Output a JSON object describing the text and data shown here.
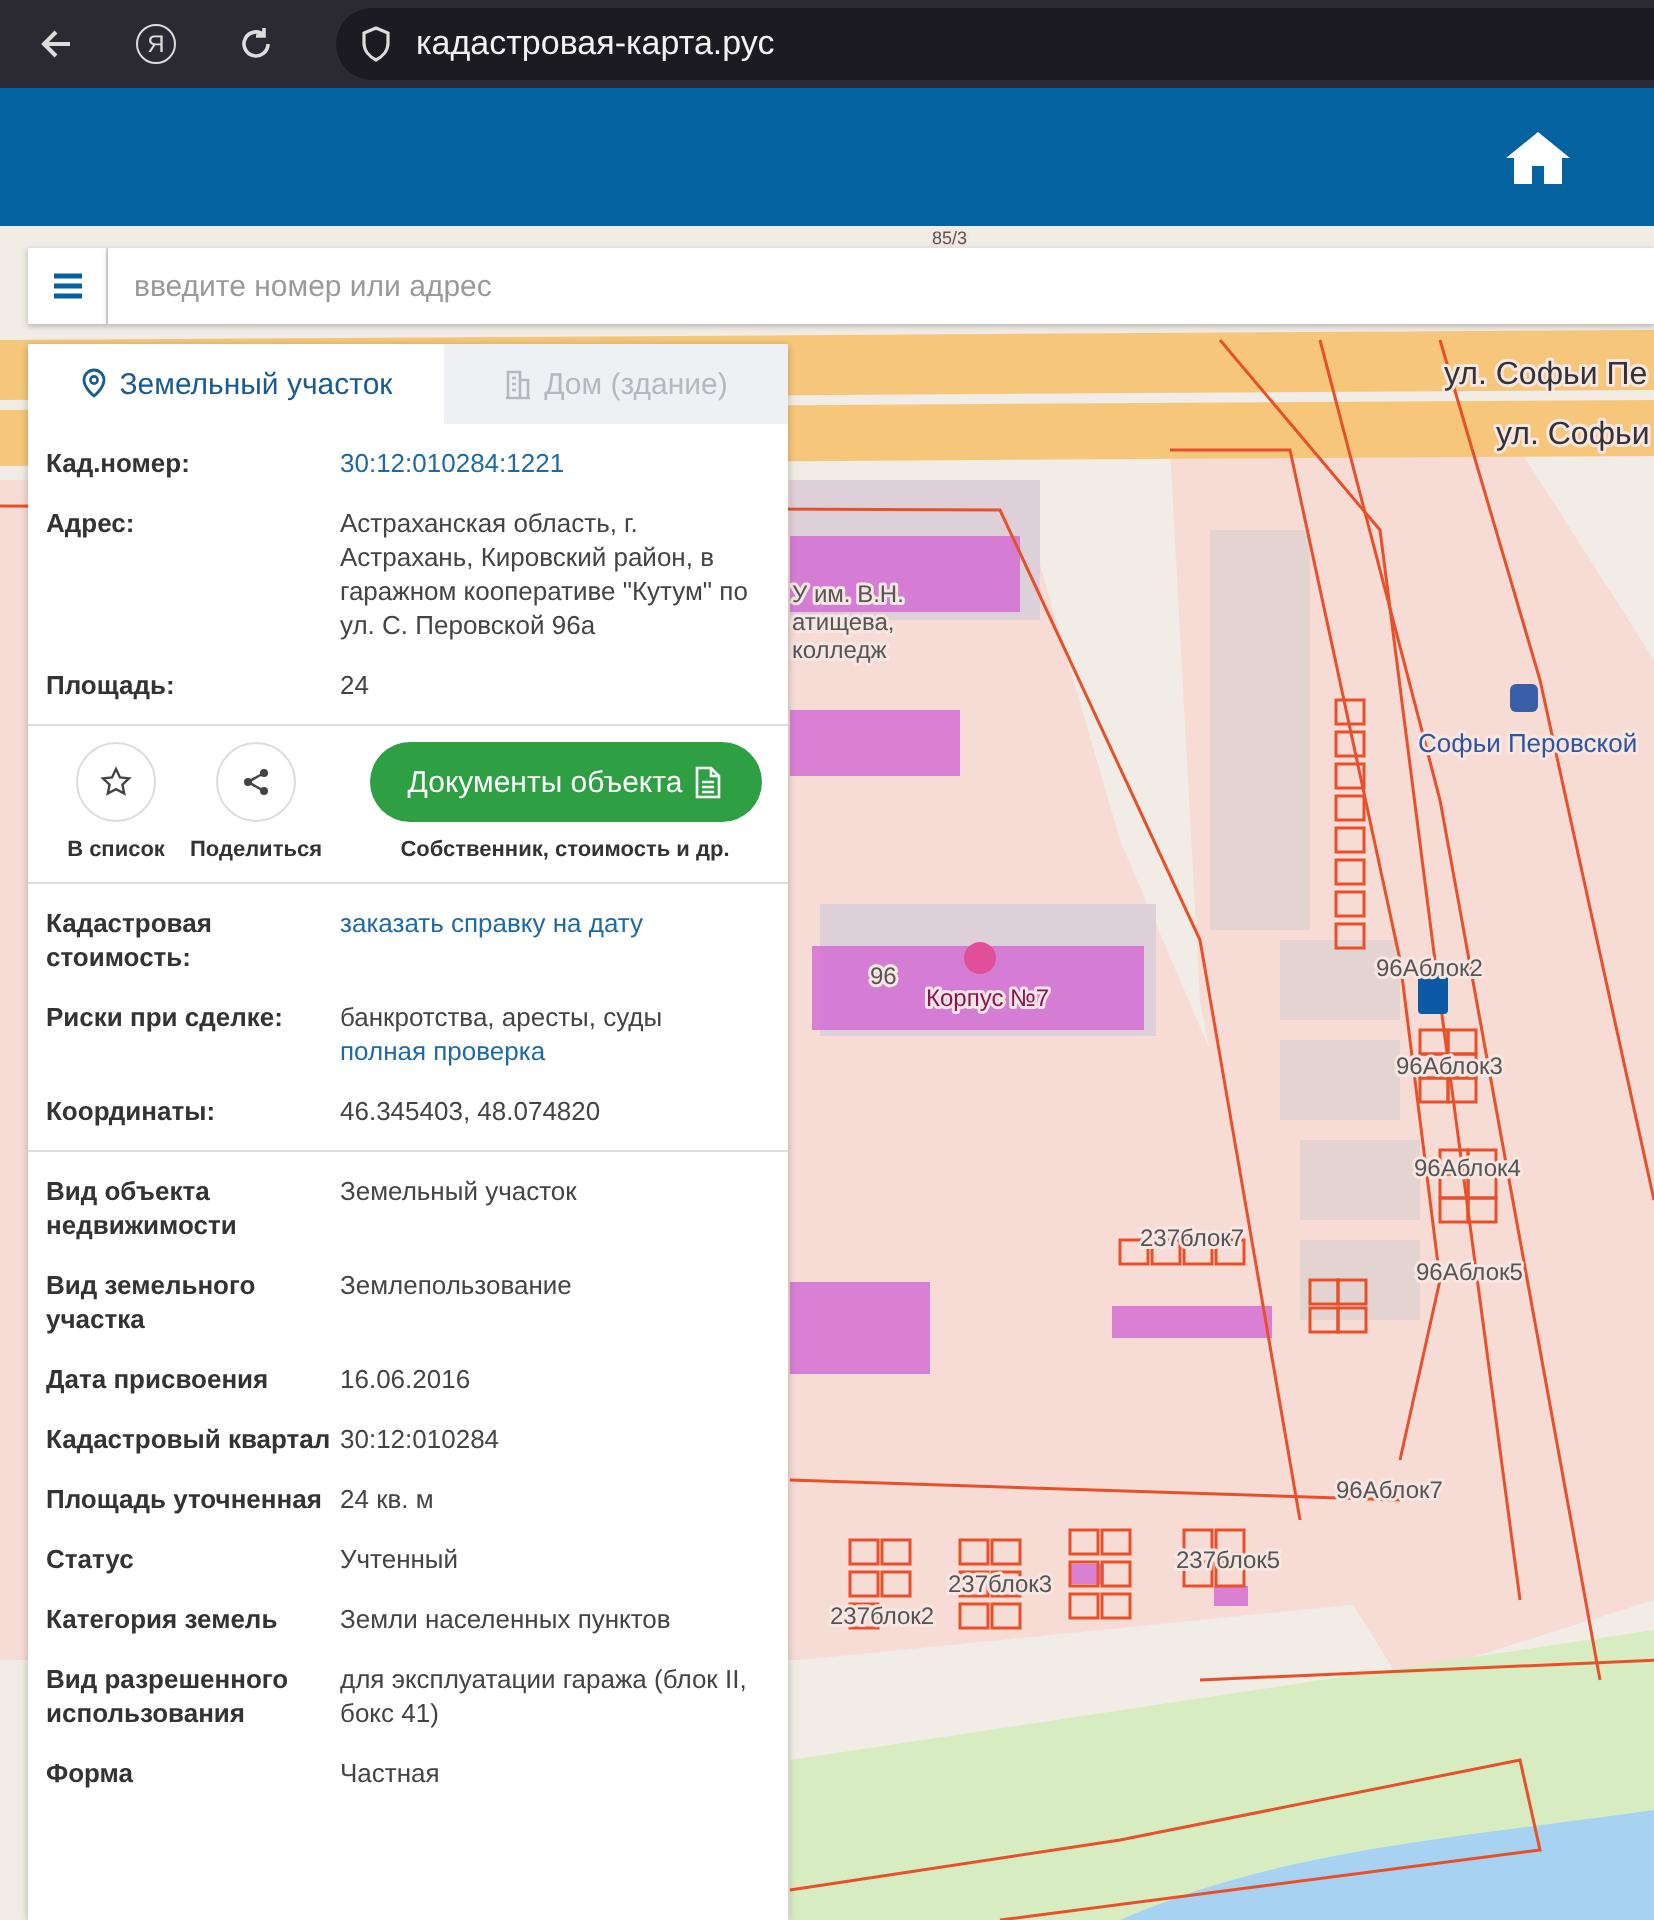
{
  "browser": {
    "logo_letter": "Я",
    "url": "кадастровая-карта.рус"
  },
  "search": {
    "placeholder": "введите номер или адрес"
  },
  "map": {
    "labels": [
      "85/3",
      "ул. Софьи Пе",
      "ул. Софьи",
      "У им. В.Н.",
      "атищева,",
      "колледж",
      "Софьи Перовской",
      "96",
      "Корпус №7",
      "96Аблок2",
      "96Аблок3",
      "96Аблок4",
      "96Аблок5",
      "237блок7",
      "96Аблок7",
      "237блок5",
      "237блок3",
      "237блок2"
    ]
  },
  "panel": {
    "tabs": [
      {
        "label": "Земельный участок",
        "selected": true
      },
      {
        "label": "Дом (здание)",
        "selected": false
      }
    ],
    "top_rows": [
      {
        "label": "Кад.номер:",
        "link": "30:12:010284:1221"
      },
      {
        "label": "Адрес:",
        "value": "Астраханская область, г. Астрахань, Кировский район, в гаражном кооперативе \"Кутум\" по ул. С. Перовской 96а"
      },
      {
        "label": "Площадь:",
        "value": "24"
      }
    ],
    "actions": [
      {
        "kind": "star",
        "label": "В список"
      },
      {
        "kind": "share",
        "label": "Поделиться"
      }
    ],
    "documents": {
      "label": "Документы объекта",
      "caption": "Собственник, стоимость и др."
    },
    "middle_rows": [
      {
        "label": "Кадастровая стоимость:",
        "link": "заказать справку на дату"
      },
      {
        "label": "Риски при сделке:",
        "value": "банкротства, аресты, суды",
        "link": "полная проверка"
      },
      {
        "label": "Координаты:",
        "value": "46.345403, 48.074820"
      }
    ],
    "bottom_rows": [
      {
        "label": "Вид объекта недвижимости",
        "value": "Земельный участок"
      },
      {
        "label": "Вид земельного участка",
        "value": "Землепользование"
      },
      {
        "label": "Дата присвоения",
        "value": "16.06.2016"
      },
      {
        "label": "Кадастровый квартал",
        "value": "30:12:010284"
      },
      {
        "label": "Площадь уточненная",
        "value": "24 кв. м"
      },
      {
        "label": "Статус",
        "value": "Учтенный"
      },
      {
        "label": "Категория земель",
        "value": "Земли населенных пунктов"
      },
      {
        "label": "Вид разрешенного использования",
        "value": "для эксплуатации гаража (блок II, бокс 41)"
      },
      {
        "label": "Форма",
        "value": "Частная"
      }
    ]
  }
}
